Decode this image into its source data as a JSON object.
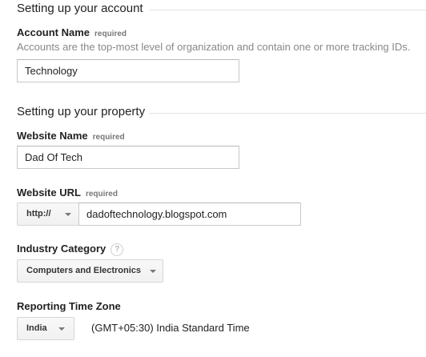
{
  "account_section": {
    "heading": "Setting up your account",
    "account_name": {
      "label": "Account Name",
      "required": "required",
      "hint": "Accounts are the top-most level of organization and contain one or more tracking IDs.",
      "value": "Technology"
    }
  },
  "property_section": {
    "heading": "Setting up your property",
    "website_name": {
      "label": "Website Name",
      "required": "required",
      "value": "Dad Of Tech"
    },
    "website_url": {
      "label": "Website URL",
      "required": "required",
      "protocol": "http://",
      "value": "dadoftechnology.blogspot.com"
    },
    "industry_category": {
      "label": "Industry Category",
      "help_glyph": "?",
      "selected": "Computers and Electronics"
    },
    "time_zone": {
      "label": "Reporting Time Zone",
      "country": "India",
      "zone": "(GMT+05:30) India Standard Time"
    }
  },
  "icons": {
    "dropdown": "chevron-down-icon",
    "help": "question-mark-icon"
  }
}
